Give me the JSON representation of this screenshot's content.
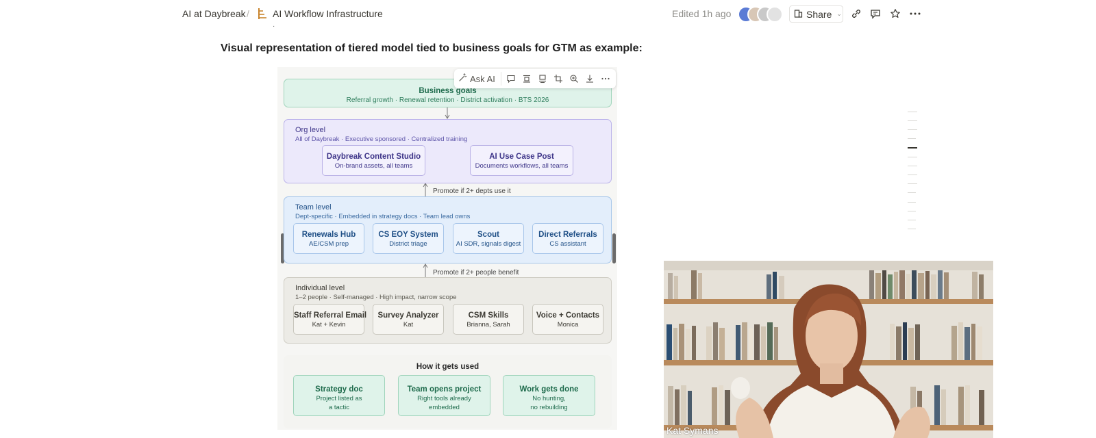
{
  "header": {
    "workspace": "AI at Daybreak",
    "separator": "/",
    "page_title": "AI Workflow Infrastructure",
    "page_icon": "ladder-emoji-icon",
    "edited": "Edited 1h ago",
    "share_label": "Share"
  },
  "content": {
    "heading": "Visual representation of tiered model tied to business goals for GTM as example:"
  },
  "image_toolbar": {
    "ask_ai": "Ask AI",
    "icons": [
      "comment-icon",
      "align-icon",
      "caption-icon",
      "crop-icon",
      "zoom-in-icon",
      "download-icon",
      "more-icon"
    ]
  },
  "diagram": {
    "business_goals": {
      "title": "Business goals",
      "subtitle": "Referral growth · Renewal retention · District activation · BTS 2026"
    },
    "org_level": {
      "title": "Org level",
      "subtitle": "All of Daybreak · Executive sponsored · Centralized training",
      "cards": [
        {
          "title": "Daybreak Content Studio",
          "sub": "On-brand assets, all teams"
        },
        {
          "title": "AI Use Case Post",
          "sub": "Documents workflows, all teams"
        }
      ]
    },
    "promote_team_to_org": "Promote if 2+ depts use it",
    "team_level": {
      "title": "Team level",
      "subtitle": "Dept-specific · Embedded in strategy docs · Team lead owns",
      "cards": [
        {
          "title": "Renewals Hub",
          "sub": "AE/CSM prep"
        },
        {
          "title": "CS EOY System",
          "sub": "District triage"
        },
        {
          "title": "Scout",
          "sub": "AI SDR, signals digest"
        },
        {
          "title": "Direct Referrals",
          "sub": "CS assistant"
        }
      ]
    },
    "promote_indiv_to_team": "Promote if 2+ people benefit",
    "individual_level": {
      "title": "Individual level",
      "subtitle": "1–2 people · Self-managed · High impact, narrow scope",
      "cards": [
        {
          "title": "Staff Referral Email",
          "sub": "Kat + Kevin"
        },
        {
          "title": "Survey Analyzer",
          "sub": "Kat"
        },
        {
          "title": "CSM Skills",
          "sub": "Brianna, Sarah"
        },
        {
          "title": "Voice + Contacts",
          "sub": "Monica"
        }
      ]
    },
    "how_it_gets_used": {
      "title": "How it gets used",
      "steps": [
        {
          "title": "Strategy doc",
          "line1": "Project listed as",
          "line2": "a tactic"
        },
        {
          "title": "Team opens project",
          "line1": "Right tools already",
          "line2": "embedded"
        },
        {
          "title": "Work gets done",
          "line1": "No hunting,",
          "line2": "no rebuilding"
        }
      ]
    }
  },
  "video": {
    "participant_name": "Kat Symans"
  },
  "colors": {
    "goals_fill": "#dff3ea",
    "org_fill": "#ece9fb",
    "team_fill": "#e3eefb",
    "individual_fill": "#ecebe6"
  }
}
